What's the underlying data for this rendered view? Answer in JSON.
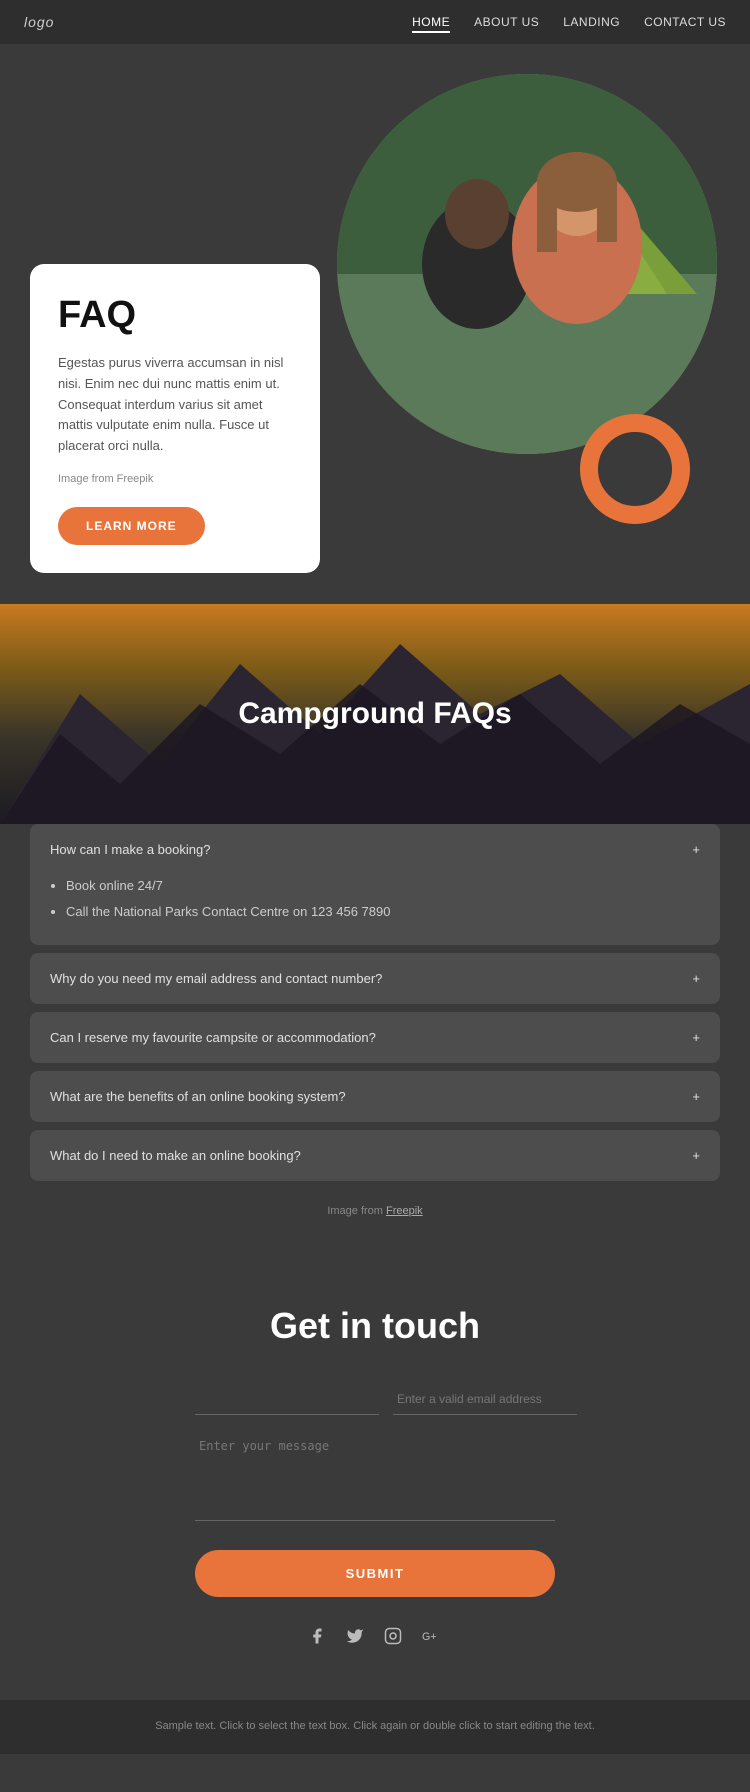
{
  "nav": {
    "logo": "logo",
    "links": [
      {
        "label": "HOME",
        "active": true
      },
      {
        "label": "ABOUT US",
        "active": false
      },
      {
        "label": "LANDING",
        "active": false
      },
      {
        "label": "CONTACT US",
        "active": false
      }
    ]
  },
  "hero": {
    "heading": "FAQ",
    "body": "Egestas purus viverra accumsan in nisl nisi. Enim nec dui nunc mattis enim ut. Consequat interdum varius sit amet mattis vulputate enim nulla. Fusce ut placerat orci nulla.",
    "image_credit": "Image from Freepik",
    "learn_more": "LEARN MORE"
  },
  "campground": {
    "title": "Campground FAQs",
    "accordions": [
      {
        "question": "How can I make a booking?",
        "open": true,
        "answer_items": [
          "Book online 24/7",
          "Call the National Parks Contact Centre on 123 456 7890"
        ]
      },
      {
        "question": "Why do you need my email address and contact number?",
        "open": false,
        "answer_items": []
      },
      {
        "question": "Can I reserve my favourite campsite or accommodation?",
        "open": false,
        "answer_items": []
      },
      {
        "question": "What are the benefits of an online booking system?",
        "open": false,
        "answer_items": []
      },
      {
        "question": "What do I need to make an online booking?",
        "open": false,
        "answer_items": []
      }
    ],
    "image_credit": "Image from Freepik"
  },
  "contact": {
    "title": "Get in touch",
    "name_placeholder": "",
    "email_placeholder": "Enter a valid email address",
    "message_placeholder": "Enter your message",
    "submit_label": "SUBMIT"
  },
  "social": {
    "icons": [
      "f",
      "🐦",
      "📷",
      "G+"
    ]
  },
  "footer": {
    "text": "Sample text. Click to select the text box. Click again or double click to start editing the text."
  }
}
